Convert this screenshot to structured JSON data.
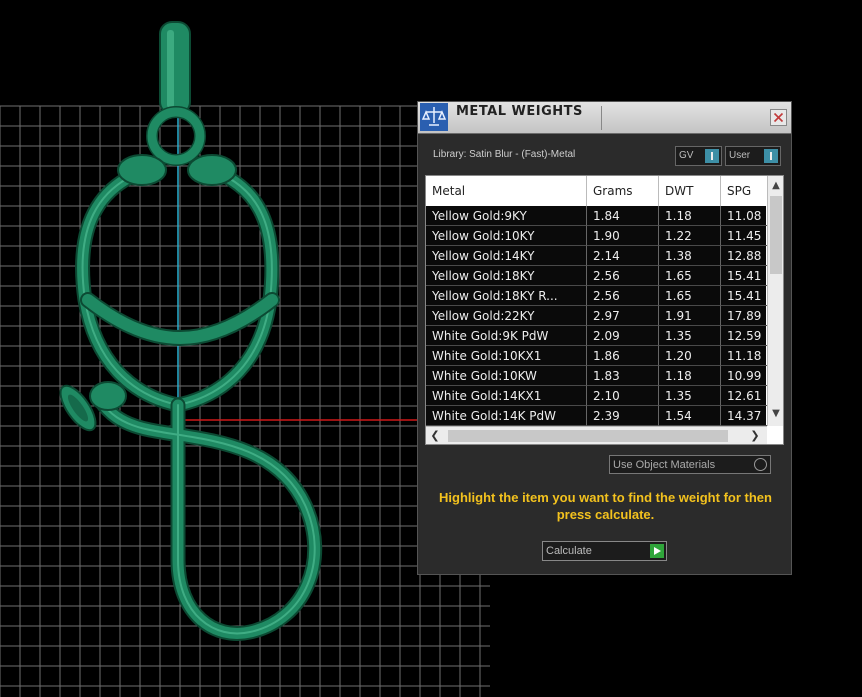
{
  "window": {
    "title": "METAL WEIGHTS",
    "library_label": "Library: Satin Blur - (Fast)-Metal",
    "toggles": {
      "gv": "GV",
      "user": "User"
    }
  },
  "table": {
    "columns": [
      "Metal",
      "Grams",
      "DWT",
      "SPG"
    ],
    "rows": [
      {
        "metal": "Yellow Gold:9KY",
        "grams": "1.84",
        "dwt": "1.18",
        "spg": "11.08"
      },
      {
        "metal": "Yellow Gold:10KY",
        "grams": "1.90",
        "dwt": "1.22",
        "spg": "11.45"
      },
      {
        "metal": "Yellow Gold:14KY",
        "grams": "2.14",
        "dwt": "1.38",
        "spg": "12.88"
      },
      {
        "metal": "Yellow Gold:18KY",
        "grams": "2.56",
        "dwt": "1.65",
        "spg": "15.41"
      },
      {
        "metal": "Yellow Gold:18KY R...",
        "grams": "2.56",
        "dwt": "1.65",
        "spg": "15.41"
      },
      {
        "metal": "Yellow Gold:22KY",
        "grams": "2.97",
        "dwt": "1.91",
        "spg": "17.89"
      },
      {
        "metal": "White Gold:9K PdW",
        "grams": "2.09",
        "dwt": "1.35",
        "spg": "12.59"
      },
      {
        "metal": "White Gold:10KX1",
        "grams": "1.86",
        "dwt": "1.20",
        "spg": "11.18"
      },
      {
        "metal": "White Gold:10KW",
        "grams": "1.83",
        "dwt": "1.18",
        "spg": "10.99"
      },
      {
        "metal": "White Gold:14KX1",
        "grams": "2.10",
        "dwt": "1.35",
        "spg": "12.61"
      },
      {
        "metal": "White Gold:14K PdW",
        "grams": "2.39",
        "dwt": "1.54",
        "spg": "14.37"
      }
    ]
  },
  "use_object_materials": "Use Object Materials",
  "hint": "Highlight the item you want to find the weight for then press calculate.",
  "calculate_label": "Calculate",
  "colors": {
    "model": "#1f8a63",
    "hint": "#f3c21e",
    "grid": "#7a7a7a",
    "axis_y": "#2ab0d0",
    "axis_x": "#d01818"
  }
}
